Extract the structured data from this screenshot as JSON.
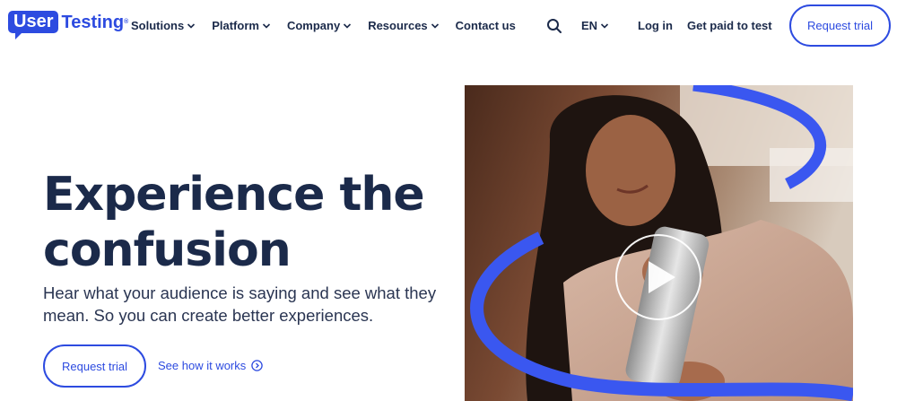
{
  "logo": {
    "box_text": "User",
    "text": "Testing",
    "tm": "®"
  },
  "nav": {
    "items": [
      {
        "label": "Solutions",
        "has_dropdown": true
      },
      {
        "label": "Platform",
        "has_dropdown": true
      },
      {
        "label": "Company",
        "has_dropdown": true
      },
      {
        "label": "Resources",
        "has_dropdown": true
      },
      {
        "label": "Contact us",
        "has_dropdown": false
      }
    ],
    "search_icon": "search-icon",
    "language": "EN",
    "login": "Log in",
    "get_paid": "Get paid to test",
    "request_trial": "Request trial"
  },
  "hero": {
    "title_line1": "Experience the",
    "title_line2": "confusion",
    "subtitle": "Hear what your audience is saying and see what they mean. So you can create better experiences.",
    "primary_button": "Request trial",
    "secondary_link": "See how it works",
    "secondary_icon": "chevron-right-circle-icon",
    "media_icon": "play-icon"
  },
  "colors": {
    "brand_blue": "#2d4be0",
    "heading_navy": "#1b2a4a",
    "ribbon_blue": "#3a57f0"
  }
}
